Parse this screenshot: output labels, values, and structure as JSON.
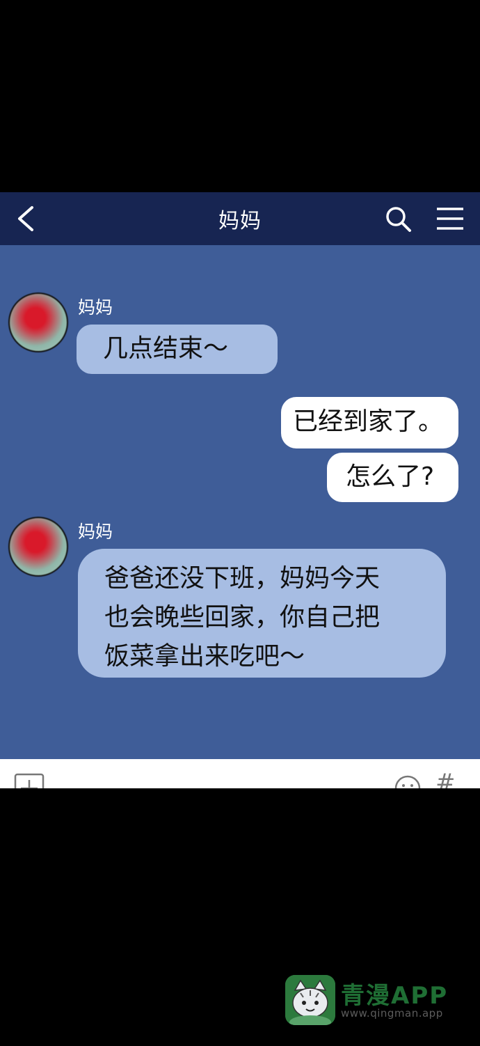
{
  "header": {
    "title": "妈妈"
  },
  "messages": [
    {
      "sender": "妈妈",
      "text": "几点结束～"
    },
    {
      "text": "已经到家了。"
    },
    {
      "text": "怎么了?"
    },
    {
      "sender": "妈妈",
      "lines": [
        "爸爸还没下班，妈妈今天",
        "也会晚些回家，你自己把",
        "饭菜拿出来吃吧～"
      ]
    }
  ],
  "input_bar": {
    "hash_label": "#"
  },
  "watermark": {
    "brand": "青漫APP",
    "site": "www.qingman.app"
  },
  "colors": {
    "header_bg": "#172552",
    "chat_bg": "#3f5d98",
    "incoming_bubble": "#a7bde3",
    "outgoing_bubble": "#ffffff",
    "watermark_green": "#2c7a3d"
  },
  "icons": [
    "back-arrow-icon",
    "search-icon",
    "menu-icon",
    "plus-icon",
    "emoji-icon",
    "hash-icon",
    "cat-logo-icon"
  ]
}
